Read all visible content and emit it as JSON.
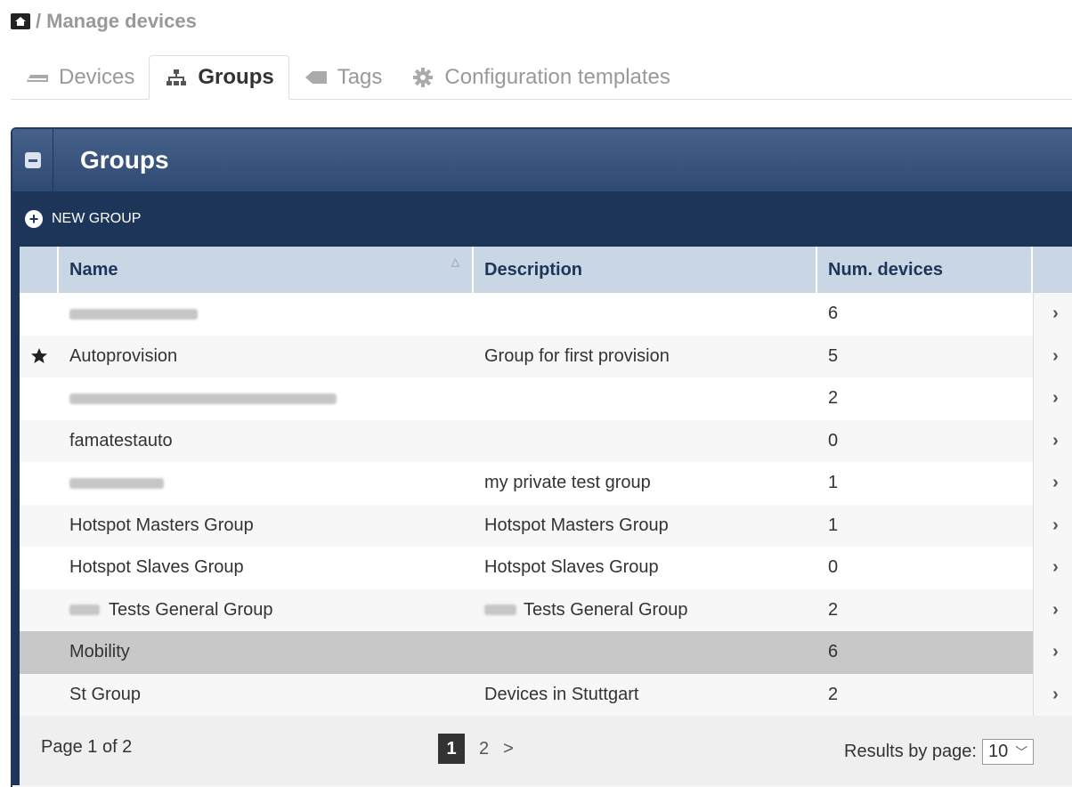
{
  "breadcrumb": {
    "separator": "/",
    "title": "Manage devices"
  },
  "tabs": [
    {
      "label": "Devices",
      "icon": "device-icon"
    },
    {
      "label": "Groups",
      "icon": "groups-icon"
    },
    {
      "label": "Tags",
      "icon": "tag-icon"
    },
    {
      "label": "Configuration templates",
      "icon": "gear-icon"
    }
  ],
  "panel": {
    "title": "Groups",
    "new_group_label": "NEW GROUP"
  },
  "table": {
    "headers": {
      "name": "Name",
      "description": "Description",
      "num_devices": "Num. devices"
    },
    "rows": [
      {
        "name": "",
        "description": "",
        "num": "6"
      },
      {
        "name": "Autoprovision",
        "description": "Group for first provision",
        "num": "5"
      },
      {
        "name": "",
        "description": "",
        "num": "2"
      },
      {
        "name": "famatestauto",
        "description": "",
        "num": "0"
      },
      {
        "name": "",
        "description": "my private test group",
        "num": "1"
      },
      {
        "name": "Hotspot Masters Group",
        "description": "Hotspot Masters Group",
        "num": "1"
      },
      {
        "name": "Hotspot Slaves Group",
        "description": "Hotspot Slaves Group",
        "num": "0"
      },
      {
        "name": "Tests General Group",
        "description": "Tests General Group",
        "num": "2"
      },
      {
        "name": "Mobility",
        "description": "",
        "num": "6"
      },
      {
        "name": "St Group",
        "description": "Devices in Stuttgart",
        "num": "2"
      }
    ],
    "arrow": "›"
  },
  "footer": {
    "page_info": "Page 1 of 2",
    "pages": [
      "1",
      "2"
    ],
    "next": ">",
    "results_label": "Results by page:",
    "results_value": "10"
  },
  "colors": {
    "header_dark": "#1d3558",
    "header_blue": "#3a5580",
    "column_header": "#c9d6e3"
  }
}
